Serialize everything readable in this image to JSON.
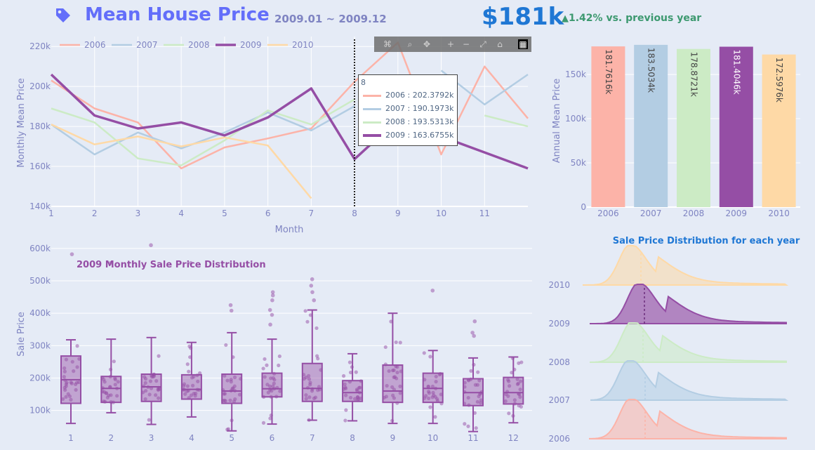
{
  "header": {
    "title": "Mean House Price",
    "date_range": "2009.01 ~ 2009.12",
    "kpi_value": "$181k",
    "kpi_delta_arrow": "▲",
    "kpi_delta_text": "1.42% vs. previous year",
    "icon": "tag-icon"
  },
  "colors": {
    "2006": "#fcb3a8",
    "2007": "#b3cde3",
    "2008": "#ccebc5",
    "2009": "#954ea5",
    "2010": "#fed9a6",
    "title": "#636efa",
    "kpi": "#1f77d4",
    "delta": "#3d9970"
  },
  "modebar_icons": [
    "camera-icon",
    "zoom-icon",
    "pan-icon",
    "zoom-in-icon",
    "zoom-out-icon",
    "autoscale-icon",
    "home-icon",
    "plotly-logo-icon"
  ],
  "hover": {
    "title": "8",
    "rows": [
      {
        "label": "2006 : 202.3792k",
        "color": "#fcb3a8"
      },
      {
        "label": "2007 : 190.1973k",
        "color": "#b3cde3"
      },
      {
        "label": "2008 : 193.5313k",
        "color": "#ccebc5"
      },
      {
        "label": "2009 : 163.6755k",
        "color": "#954ea5"
      }
    ]
  },
  "chart_data": [
    {
      "type": "line",
      "xlabel": "Month",
      "ylabel": "Monthly Mean Price",
      "x_ticks": [
        "1",
        "2",
        "3",
        "4",
        "5",
        "6",
        "7",
        "8",
        "9",
        "10",
        "11"
      ],
      "y_ticks": [
        "140k",
        "160k",
        "180k",
        "200k",
        "220k"
      ],
      "ylim": [
        140000,
        225000
      ],
      "xlim": [
        1,
        12
      ],
      "legend": "top-left, horizontal",
      "series": [
        {
          "name": "2006",
          "x": [
            1,
            2,
            3,
            4,
            5,
            6,
            7,
            8,
            9,
            10,
            11,
            12
          ],
          "y": [
            203000,
            189000,
            182000,
            159000,
            169500,
            174000,
            179000,
            202379,
            222000,
            166000,
            210000,
            184000
          ]
        },
        {
          "name": "2007",
          "x": [
            1,
            2,
            3,
            4,
            5,
            6,
            7,
            8,
            9,
            10,
            11,
            12
          ],
          "y": [
            181000,
            166000,
            177000,
            169000,
            177000,
            187000,
            178000,
            190197,
            null,
            208000,
            191000,
            206000
          ]
        },
        {
          "name": "2008",
          "x": [
            1,
            2,
            3,
            4,
            5,
            6,
            7,
            8,
            9,
            10,
            11,
            12
          ],
          "y": [
            189000,
            182000,
            164000,
            160500,
            173000,
            188000,
            181000,
            193531,
            null,
            null,
            185500,
            180000
          ]
        },
        {
          "name": "2009",
          "x": [
            1,
            2,
            3,
            4,
            5,
            6,
            7,
            8,
            9,
            10,
            11,
            12
          ],
          "y": [
            206000,
            185500,
            179000,
            182000,
            175500,
            184500,
            199000,
            163676,
            183500,
            175000,
            167000,
            159000
          ]
        },
        {
          "name": "2010",
          "x": [
            1,
            2,
            3,
            4,
            5,
            6,
            7
          ],
          "y": [
            181000,
            171000,
            175000,
            170000,
            174500,
            170500,
            144000
          ]
        }
      ]
    },
    {
      "type": "bar",
      "ylabel": "Annual Mean Price",
      "categories": [
        "2006",
        "2007",
        "2008",
        "2009",
        "2010"
      ],
      "values": [
        181761.6,
        183503.4,
        178872.1,
        181404.6,
        172597.6
      ],
      "labels": [
        "181.7616k",
        "183.5034k",
        "178.8721k",
        "181.4046k",
        "172.5976k"
      ],
      "y_ticks": [
        "0",
        "50k",
        "100k",
        "150k"
      ],
      "ylim": [
        0,
        185000
      ]
    },
    {
      "type": "box",
      "title": "2009 Monthly Sale Price Distribution",
      "ylabel": "Sale Price",
      "categories": [
        "1",
        "2",
        "3",
        "4",
        "5",
        "6",
        "7",
        "8",
        "9",
        "10",
        "11",
        "12"
      ],
      "y_ticks": [
        "100k",
        "200k",
        "300k",
        "400k",
        "500k",
        "600k"
      ],
      "ylim": [
        30000,
        630000
      ],
      "boxes": [
        {
          "min": 60000,
          "q1": 122000,
          "median": 195000,
          "q3": 268000,
          "max": 318000,
          "outliers": [
            582000
          ]
        },
        {
          "min": 93000,
          "q1": 125000,
          "median": 168000,
          "q3": 205000,
          "max": 320000,
          "outliers": [
            555000
          ]
        },
        {
          "min": 57000,
          "q1": 128000,
          "median": 173000,
          "q3": 212000,
          "max": 325000,
          "outliers": [
            610000
          ]
        },
        {
          "min": 80000,
          "q1": 135000,
          "median": 165000,
          "q3": 210000,
          "max": 310000,
          "outliers": [
            555000
          ]
        },
        {
          "min": 37000,
          "q1": 122000,
          "median": 160000,
          "q3": 212000,
          "max": 340000,
          "outliers": [
            408000,
            425000
          ]
        },
        {
          "min": 58000,
          "q1": 142000,
          "median": 167000,
          "q3": 215000,
          "max": 320000,
          "outliers": [
            365000,
            395000,
            410000,
            440000,
            455000,
            465000
          ]
        },
        {
          "min": 70000,
          "q1": 128000,
          "median": 168000,
          "q3": 245000,
          "max": 410000,
          "outliers": [
            440000,
            465000,
            485000,
            505000
          ]
        },
        {
          "min": 68000,
          "q1": 128000,
          "median": 155000,
          "q3": 192000,
          "max": 275000,
          "outliers": []
        },
        {
          "min": 60000,
          "q1": 125000,
          "median": 160000,
          "q3": 240000,
          "max": 400000,
          "outliers": []
        },
        {
          "min": 60000,
          "q1": 125000,
          "median": 168000,
          "q3": 215000,
          "max": 285000,
          "outliers": [
            470000
          ]
        },
        {
          "min": 35000,
          "q1": 115000,
          "median": 155000,
          "q3": 198000,
          "max": 262000,
          "outliers": [
            330000,
            340000,
            375000
          ]
        },
        {
          "min": 62000,
          "q1": 120000,
          "median": 155000,
          "q3": 202000,
          "max": 265000,
          "outliers": []
        }
      ]
    },
    {
      "type": "area",
      "title": "Sale Price Distribution for each year",
      "categories": [
        "2006",
        "2007",
        "2008",
        "2009",
        "2010"
      ],
      "note": "ridgeline density plot, one ridge per year, dashed vertical line at each year's mean"
    }
  ]
}
